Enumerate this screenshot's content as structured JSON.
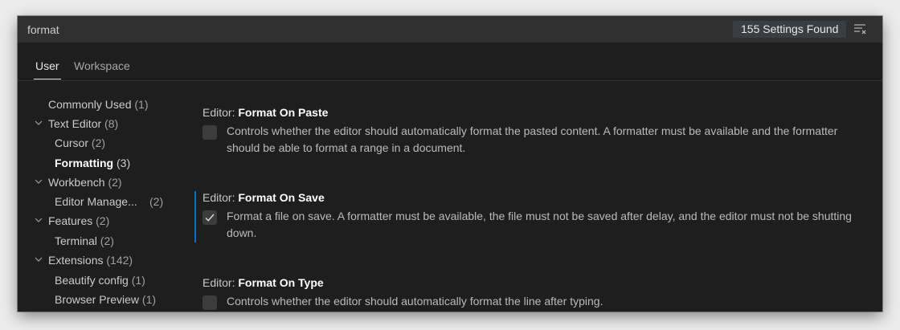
{
  "search": {
    "value": "format",
    "result_count": "155 Settings Found",
    "clear_icon": "clear-filter-icon"
  },
  "tabs": [
    {
      "label": "User",
      "active": true
    },
    {
      "label": "Workspace",
      "active": false
    }
  ],
  "toc": [
    {
      "label": "Commonly Used",
      "count": "(1)"
    },
    {
      "label": "Text Editor",
      "count": "(8)",
      "expanded": true
    },
    {
      "label": "Cursor",
      "count": "(2)"
    },
    {
      "label": "Formatting",
      "count": "(3)",
      "selected": true
    },
    {
      "label": "Workbench",
      "count": "(2)",
      "expanded": true
    },
    {
      "label": "Editor Manage...",
      "count": "(2)"
    },
    {
      "label": "Features",
      "count": "(2)",
      "expanded": true
    },
    {
      "label": "Terminal",
      "count": "(2)"
    },
    {
      "label": "Extensions",
      "count": "(142)",
      "expanded": true
    },
    {
      "label": "Beautify config",
      "count": "(1)"
    },
    {
      "label": "Browser Preview",
      "count": "(1)"
    }
  ],
  "settings": [
    {
      "category": "Editor: ",
      "name": "Format On Paste",
      "checked": false,
      "description_1": "Controls whether the editor should automatically format the pasted content. A formatter must be available and the formatter",
      "description_2": "should be able to format a range in a document."
    },
    {
      "category": "Editor: ",
      "name": "Format On Save",
      "checked": true,
      "description_1": "Format a file on save. A formatter must be available, the file must not be saved after delay, and the editor must not be shutting",
      "description_2": "down."
    },
    {
      "category": "Editor: ",
      "name": "Format On Type",
      "checked": false,
      "description_1": "Controls whether the editor should automatically format the line after typing."
    }
  ],
  "colors": {
    "background": "#1e1e1e",
    "accent": "#0e70c0",
    "searchbar": "#303031"
  }
}
